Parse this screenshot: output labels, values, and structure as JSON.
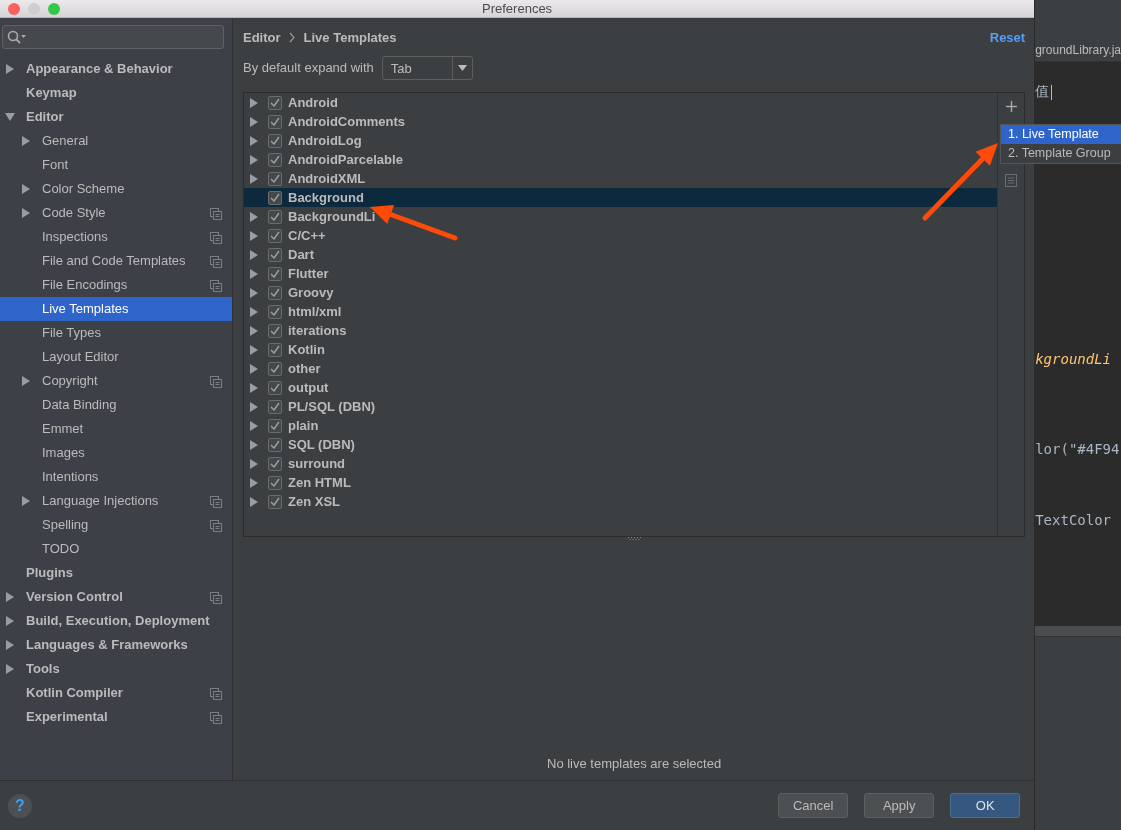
{
  "window": {
    "title": "Preferences"
  },
  "sidebar": {
    "items": [
      {
        "label": "Appearance & Behavior",
        "kind": "collapsed",
        "project_level": false,
        "selected": false
      },
      {
        "label": "Keymap",
        "kind": "leaf",
        "project_level": false,
        "selected": false
      },
      {
        "label": "Editor",
        "kind": "expanded",
        "project_level": false,
        "selected": false,
        "children": [
          {
            "label": "General",
            "kind": "collapsed",
            "project_level": false,
            "selected": false
          },
          {
            "label": "Font",
            "kind": "leaf",
            "project_level": false,
            "selected": false
          },
          {
            "label": "Color Scheme",
            "kind": "collapsed",
            "project_level": false,
            "selected": false
          },
          {
            "label": "Code Style",
            "kind": "collapsed",
            "project_level": true,
            "selected": false
          },
          {
            "label": "Inspections",
            "kind": "leaf",
            "project_level": true,
            "selected": false
          },
          {
            "label": "File and Code Templates",
            "kind": "leaf",
            "project_level": true,
            "selected": false
          },
          {
            "label": "File Encodings",
            "kind": "leaf",
            "project_level": true,
            "selected": false
          },
          {
            "label": "Live Templates",
            "kind": "leaf",
            "project_level": false,
            "selected": true
          },
          {
            "label": "File Types",
            "kind": "leaf",
            "project_level": false,
            "selected": false
          },
          {
            "label": "Layout Editor",
            "kind": "leaf",
            "project_level": false,
            "selected": false
          },
          {
            "label": "Copyright",
            "kind": "collapsed",
            "project_level": true,
            "selected": false
          },
          {
            "label": "Data Binding",
            "kind": "leaf",
            "project_level": false,
            "selected": false
          },
          {
            "label": "Emmet",
            "kind": "leaf",
            "project_level": false,
            "selected": false
          },
          {
            "label": "Images",
            "kind": "leaf",
            "project_level": false,
            "selected": false
          },
          {
            "label": "Intentions",
            "kind": "leaf",
            "project_level": false,
            "selected": false
          },
          {
            "label": "Language Injections",
            "kind": "collapsed",
            "project_level": true,
            "selected": false
          },
          {
            "label": "Spelling",
            "kind": "leaf",
            "project_level": true,
            "selected": false
          },
          {
            "label": "TODO",
            "kind": "leaf",
            "project_level": false,
            "selected": false
          }
        ]
      },
      {
        "label": "Plugins",
        "kind": "leaf",
        "project_level": false,
        "selected": false
      },
      {
        "label": "Version Control",
        "kind": "collapsed",
        "project_level": true,
        "selected": false
      },
      {
        "label": "Build, Execution, Deployment",
        "kind": "collapsed",
        "project_level": false,
        "selected": false
      },
      {
        "label": "Languages & Frameworks",
        "kind": "collapsed",
        "project_level": false,
        "selected": false
      },
      {
        "label": "Tools",
        "kind": "collapsed",
        "project_level": false,
        "selected": false
      },
      {
        "label": "Kotlin Compiler",
        "kind": "leaf",
        "project_level": true,
        "selected": false
      },
      {
        "label": "Experimental",
        "kind": "leaf",
        "project_level": true,
        "selected": false
      }
    ]
  },
  "header": {
    "breadcrumb": [
      "Editor",
      "Live Templates"
    ],
    "reset": "Reset"
  },
  "expand_with": {
    "label": "By default expand with",
    "value": "Tab"
  },
  "templates": [
    {
      "label": "Android",
      "checked": true,
      "kind": "group",
      "selected": false
    },
    {
      "label": "AndroidComments",
      "checked": true,
      "kind": "group",
      "selected": false
    },
    {
      "label": "AndroidLog",
      "checked": true,
      "kind": "group",
      "selected": false
    },
    {
      "label": "AndroidParcelable",
      "checked": true,
      "kind": "group",
      "selected": false
    },
    {
      "label": "AndroidXML",
      "checked": true,
      "kind": "group",
      "selected": false
    },
    {
      "label": "Background",
      "checked": true,
      "kind": "empty",
      "selected": true
    },
    {
      "label": "BackgroundLi",
      "checked": true,
      "kind": "group",
      "selected": false
    },
    {
      "label": "C/C++",
      "checked": true,
      "kind": "group",
      "selected": false
    },
    {
      "label": "Dart",
      "checked": true,
      "kind": "group",
      "selected": false
    },
    {
      "label": "Flutter",
      "checked": true,
      "kind": "group",
      "selected": false
    },
    {
      "label": "Groovy",
      "checked": true,
      "kind": "group",
      "selected": false
    },
    {
      "label": "html/xml",
      "checked": true,
      "kind": "group",
      "selected": false
    },
    {
      "label": "iterations",
      "checked": true,
      "kind": "group",
      "selected": false
    },
    {
      "label": "Kotlin",
      "checked": true,
      "kind": "group",
      "selected": false
    },
    {
      "label": "other",
      "checked": true,
      "kind": "group",
      "selected": false
    },
    {
      "label": "output",
      "checked": true,
      "kind": "group",
      "selected": false
    },
    {
      "label": "PL/SQL (DBN)",
      "checked": true,
      "kind": "group",
      "selected": false
    },
    {
      "label": "plain",
      "checked": true,
      "kind": "group",
      "selected": false
    },
    {
      "label": "SQL (DBN)",
      "checked": true,
      "kind": "group",
      "selected": false
    },
    {
      "label": "surround",
      "checked": true,
      "kind": "group",
      "selected": false
    },
    {
      "label": "Zen HTML",
      "checked": true,
      "kind": "group",
      "selected": false
    },
    {
      "label": "Zen XSL",
      "checked": true,
      "kind": "group",
      "selected": false
    }
  ],
  "add_menu": {
    "items": [
      {
        "label": "1. Live Template",
        "selected": true
      },
      {
        "label": "2. Template Group",
        "selected": false
      }
    ]
  },
  "empty_message": "No live templates are selected",
  "help": "?",
  "buttons": [
    {
      "label": "Cancel",
      "kind": "default"
    },
    {
      "label": "Apply",
      "kind": "default"
    },
    {
      "label": "OK",
      "kind": "primary"
    }
  ],
  "background_editor": {
    "tab": "groundLibrary.ja",
    "lines": [
      {
        "text": "值",
        "kind": "plain"
      },
      {
        "text": "kgroundLi",
        "kind": "class"
      },
      {
        "text": "lor(\"#4F94",
        "kind": "plain"
      },
      {
        "text": "TextColor",
        "kind": "plain"
      }
    ]
  }
}
